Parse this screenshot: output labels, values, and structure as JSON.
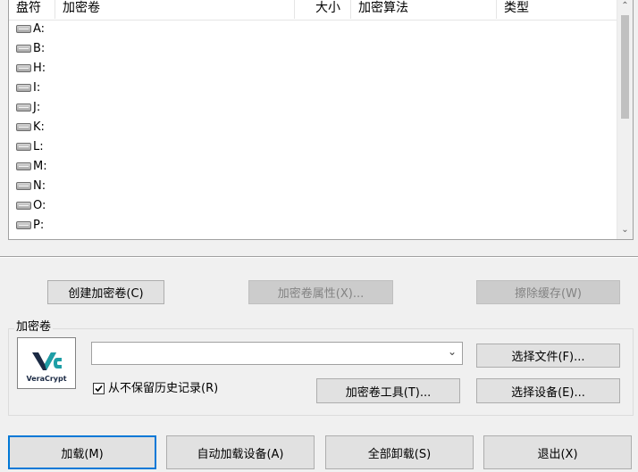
{
  "drive_list": {
    "columns": {
      "drive": "盘符",
      "volume": "加密卷",
      "size": "大小",
      "algorithm": "加密算法",
      "type": "类型"
    },
    "drives": [
      "A:",
      "B:",
      "H:",
      "I:",
      "J:",
      "K:",
      "L:",
      "M:",
      "N:",
      "O:",
      "P:"
    ],
    "scroll_up_icon": "chevron-up-icon",
    "scroll_down_icon": "chevron-down-icon"
  },
  "buttons": {
    "create_volume": "创建加密卷(C)",
    "volume_properties": "加密卷属性(X)...",
    "wipe_cache": "擦除缓存(W)",
    "select_file": "选择文件(F)...",
    "volume_tools": "加密卷工具(T)...",
    "select_device": "选择设备(E)...",
    "mount": "加载(M)",
    "auto_mount": "自动加载设备(A)",
    "dismount_all": "全部卸载(S)",
    "exit": "退出(X)"
  },
  "volume_group": {
    "title": "加密卷",
    "path_value": "",
    "never_save_history_label": "从不保留历史记录(R)",
    "never_save_history_checked": true,
    "logo_text": "VeraCrypt"
  },
  "colors": {
    "default_button_border": "#0078d7",
    "logo_teal": "#1e9ea6",
    "logo_navy": "#1b2a44"
  }
}
